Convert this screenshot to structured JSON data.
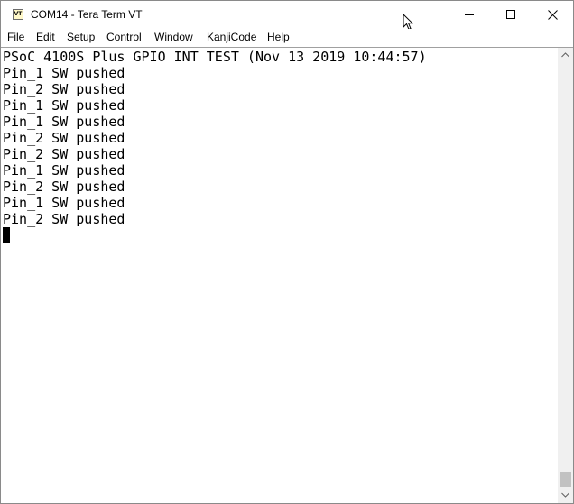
{
  "window": {
    "title": "COM14 - Tera Term VT",
    "icon_label": "VT"
  },
  "menu": {
    "items": [
      "File",
      "Edit",
      "Setup",
      "Control",
      "Window",
      "KanjiCode",
      "Help"
    ]
  },
  "terminal": {
    "lines": [
      "PSoC 4100S Plus GPIO INT TEST (Nov 13 2019 10:44:57)",
      "Pin_1 SW pushed",
      "Pin_2 SW pushed",
      "Pin_1 SW pushed",
      "Pin_1 SW pushed",
      "Pin_2 SW pushed",
      "Pin_2 SW pushed",
      "Pin_1 SW pushed",
      "Pin_2 SW pushed",
      "Pin_1 SW pushed",
      "Pin_2 SW pushed"
    ]
  },
  "icons": {
    "minimize": "minimize-icon",
    "maximize": "maximize-icon",
    "close": "close-icon",
    "app": "tera-term-vt-icon",
    "pointer": "mouse-pointer-icon"
  },
  "colors": {
    "terminal_bg": "#ffffff",
    "terminal_fg": "#000000",
    "scrollbar_bg": "#f0f0f0",
    "scroll_thumb": "#c2c2c2"
  }
}
